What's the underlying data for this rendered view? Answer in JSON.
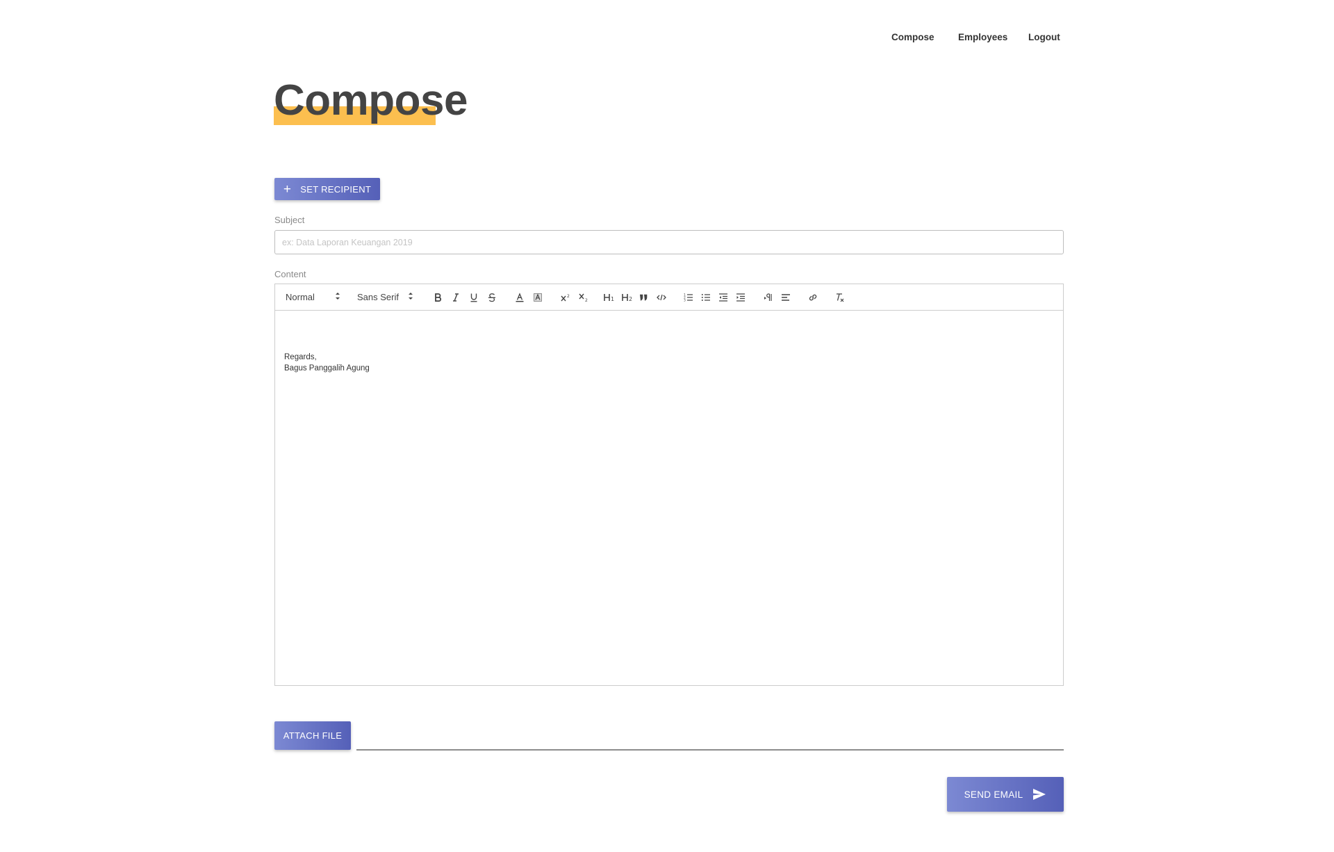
{
  "nav": {
    "items": [
      "Compose",
      "Employees",
      "Logout"
    ]
  },
  "page": {
    "title": "Compose",
    "highlight_color": "#fcbf4f"
  },
  "recipient_button": {
    "icon": "plus-icon",
    "label": "SET RECIPIENT"
  },
  "subject": {
    "label": "Subject",
    "value": "",
    "placeholder": "ex: Data Laporan Keuangan 2019"
  },
  "content": {
    "label": "Content",
    "toolbar": {
      "header_picker": "Normal",
      "font_picker": "Sans Serif",
      "buttons": [
        "bold-icon",
        "italic-icon",
        "underline-icon",
        "strike-icon",
        "text-color-icon",
        "background-color-icon",
        "superscript-icon",
        "subscript-icon",
        "header-1-icon",
        "header-2-icon",
        "blockquote-icon",
        "code-icon",
        "ordered-list-icon",
        "bullet-list-icon",
        "outdent-icon",
        "indent-icon",
        "rtl-direction-icon",
        "align-icon",
        "link-icon",
        "clean-format-icon"
      ]
    },
    "body_lines": [
      "Regards,",
      "Bagus Panggalih Agung"
    ]
  },
  "attach_button": {
    "label": "ATTACH FILE"
  },
  "send_button": {
    "label": "SEND EMAIL",
    "icon": "send-icon"
  },
  "colors": {
    "button_gradient_start": "#7c89d3",
    "button_gradient_end": "#5560b8"
  }
}
